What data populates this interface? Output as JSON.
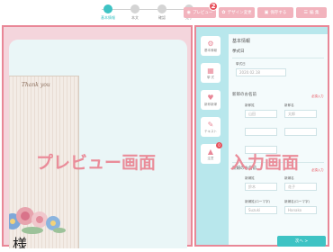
{
  "steps": [
    {
      "label": "基本情報",
      "active": true
    },
    {
      "label": "本文",
      "active": false
    },
    {
      "label": "確認",
      "active": false
    },
    {
      "label": "完了",
      "active": false
    }
  ],
  "toolbar": {
    "preview_label": "プレビュー",
    "design_label": "デザイン変更",
    "save_label": "保存する",
    "menu_label": "編 集",
    "badge_count": "2"
  },
  "preview": {
    "thanks_text": "Thank you",
    "name_suffix": "様",
    "overlay_label": "プレビュー画面"
  },
  "input": {
    "overlay_label": "入力画面",
    "side_items": [
      {
        "icon": "gear-icon",
        "glyph": "⚙",
        "label": "基本情報"
      },
      {
        "icon": "calendar-icon",
        "glyph": "▦",
        "label": "挙 式"
      },
      {
        "icon": "people-icon",
        "glyph": "♥",
        "label": "新郎新婦"
      },
      {
        "icon": "text-icon",
        "glyph": "✎",
        "label": "テキスト"
      },
      {
        "icon": "alert-icon",
        "glyph": "▲",
        "label": "注意",
        "badge": "0"
      }
    ],
    "form": {
      "section_basic": "基本情報",
      "label_ceremony_date": "挙式日",
      "label_date": "挙式日",
      "date_value": "2020.02.18",
      "section_groom": "新郎のお名前",
      "section_bride": "新婦のお名前",
      "required": "必須入力",
      "label_last": "新郎姓",
      "label_first": "新郎名",
      "placeholder_last": "山田",
      "placeholder_first": "太郎",
      "label_bride_last": "新婦姓",
      "label_bride_first": "新婦名",
      "placeholder_bride_last": "鈴木",
      "placeholder_bride_first": "花子",
      "label_roman_last": "新婦姓(ローマ字)",
      "label_roman_first": "新婦名(ローマ字)",
      "placeholder_roman_last": "Suzuki",
      "placeholder_roman_first": "Hanako",
      "next_label": "次へ"
    }
  },
  "colors": {
    "accent": "#3ec3c4",
    "pink_border": "#e98797",
    "pink_button": "#f2b3bd",
    "badge_red": "#e8505b",
    "input_bg": "#b8e7ec",
    "preview_bg": "#f4d5dc"
  }
}
